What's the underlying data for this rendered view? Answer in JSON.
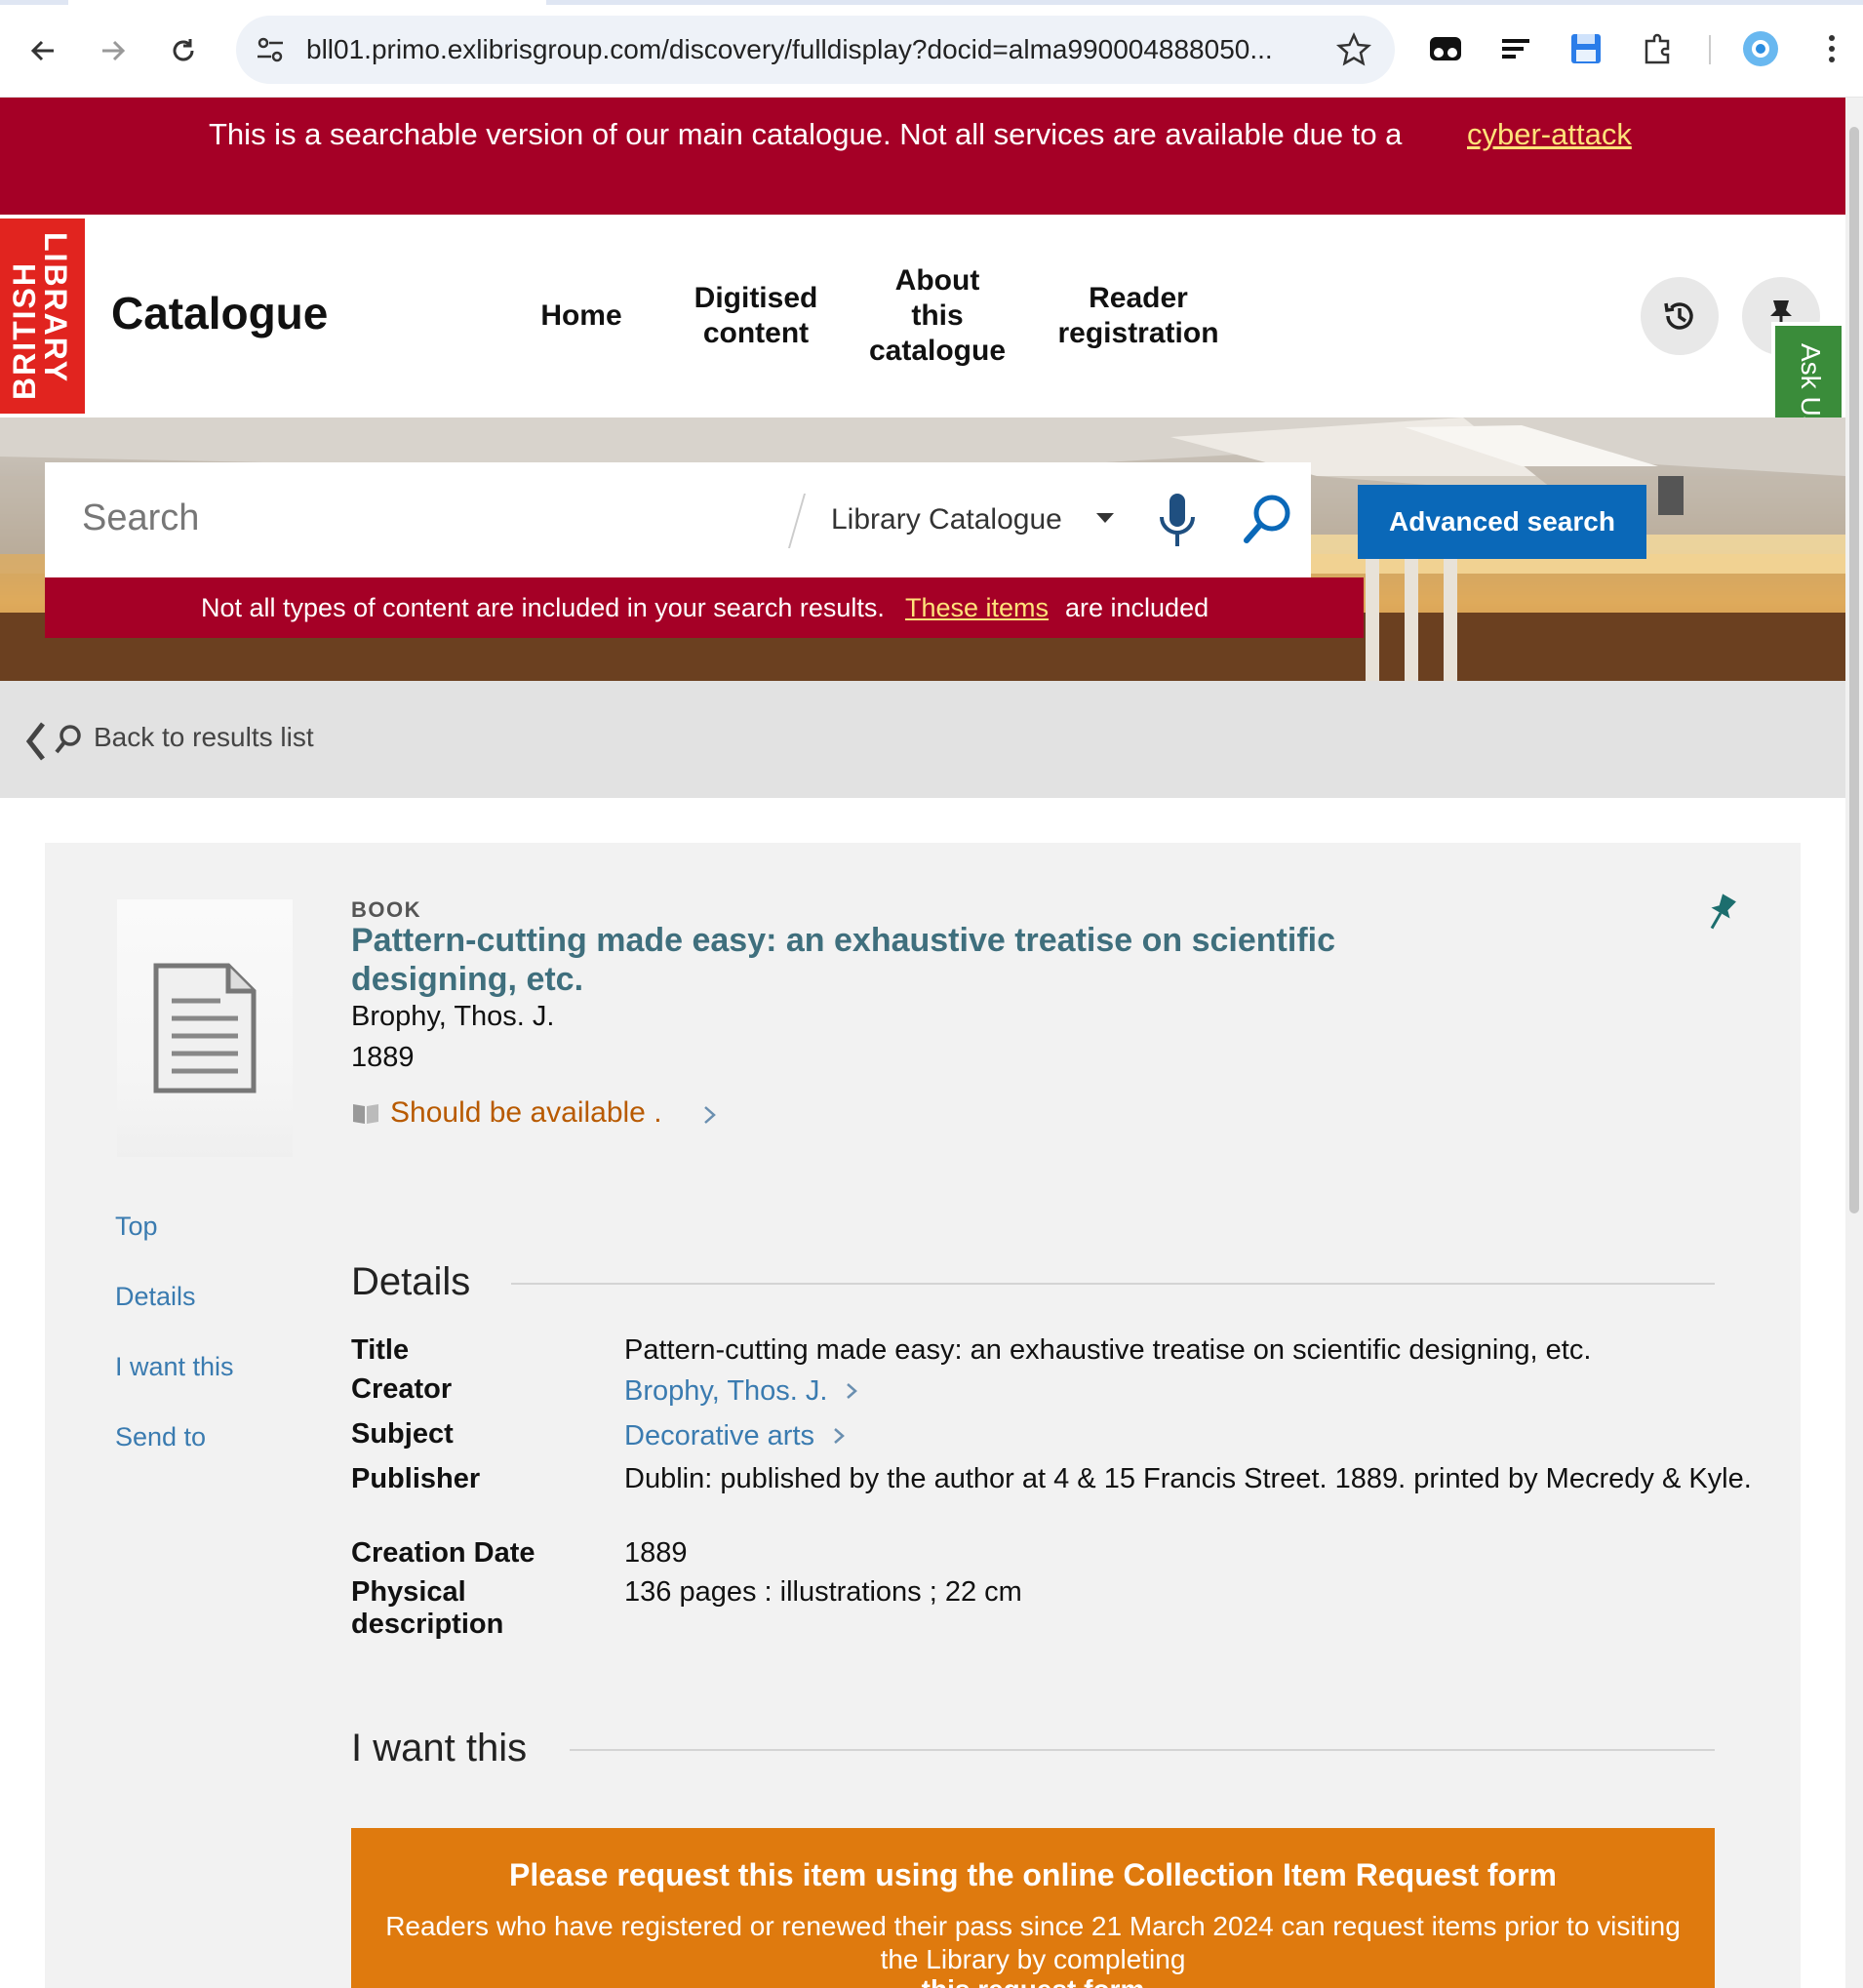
{
  "browser": {
    "url": "bll01.primo.exlibrisgroup.com/discovery/fulldisplay?docid=alma990004888050..."
  },
  "banner": {
    "text": "This is a searchable version of our main catalogue. Not all services are available due to a",
    "link": "cyber-attack"
  },
  "header": {
    "logo_line1": "BRITISH",
    "logo_line2": "LIBRARY",
    "title": "Catalogue",
    "menu": [
      {
        "line1": "Home",
        "line2": "",
        "line3": ""
      },
      {
        "line1": "Digitised",
        "line2": "content",
        "line3": ""
      },
      {
        "line1": "About",
        "line2": "this",
        "line3": "catalogue"
      },
      {
        "line1": "Reader",
        "line2": "registration",
        "line3": ""
      }
    ],
    "ask_us": "Ask Us"
  },
  "search": {
    "placeholder": "Search",
    "scope": "Library Catalogue",
    "advanced": "Advanced search",
    "notice_text": "Not all types of content are included in your search results.",
    "notice_link": "These items",
    "notice_tail": "are included"
  },
  "back": {
    "label": "Back to results list"
  },
  "record": {
    "type": "BOOK",
    "title": "Pattern-cutting made easy: an exhaustive treatise on scientific designing, etc.",
    "creator": "Brophy, Thos. J.",
    "year": "1889",
    "availability": "Should be available ."
  },
  "sidenav": [
    "Top",
    "Details",
    "I want this",
    "Send to"
  ],
  "details": {
    "heading": "Details",
    "rows": [
      {
        "label": "Title",
        "value": "Pattern-cutting made easy: an exhaustive treatise on scientific designing, etc."
      },
      {
        "label": "Creator",
        "value": "Brophy, Thos. J."
      },
      {
        "label": "Subject",
        "value": "Decorative arts"
      },
      {
        "label": "Publisher",
        "value": "Dublin: published by the author at 4 & 15 Francis Street. 1889. printed by Mecredy & Kyle."
      },
      {
        "label": "Creation Date",
        "value": "1889"
      },
      {
        "label": "Physical description",
        "value": "136 pages : illustrations ; 22 cm"
      }
    ]
  },
  "iwant": {
    "heading": "I want this",
    "request_title": "Please request this item using the online Collection Item Request form",
    "request_text": "Readers who have registered or renewed their pass since 21 March 2024 can request items prior to visiting the Library by completing",
    "request_link": "this request form"
  },
  "colors": {
    "alert_red": "#a50026",
    "brand_red": "#e1241f",
    "primary_blue": "#0a68b8",
    "link_blue": "#3a7bb0",
    "title_teal": "#3f6f7d",
    "avail_orange": "#b85a00",
    "request_orange": "#df7a0e",
    "askus_green": "#3a8c3a"
  }
}
